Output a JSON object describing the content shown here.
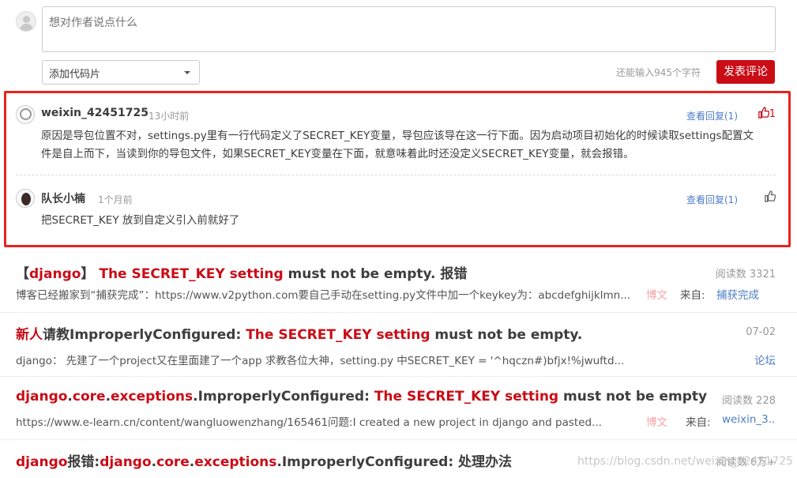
{
  "composer": {
    "placeholder": "想对作者说点什么",
    "code_select": "添加代码片",
    "char_count": "还能输入945个字符",
    "submit": "发表评论"
  },
  "comments": [
    {
      "user": "weixin_42451725",
      "time": "13小时前",
      "reply": "查看回复(1)",
      "likes": "1",
      "text1": "原因是导包位置不对，settings.py里有一行代码定义了SECRET_KEY变量，导包应该导在这一行下面。因为启动项目初始化的时候读取settings配置文",
      "text2": "件是自上而下，当读到你的导包文件，如果SECRET_KEY变量在下面，就意味着此时还没定义SECRET_KEY变量，就会报错。"
    },
    {
      "user": "队长小楠",
      "time": "1个月前",
      "reply": "查看回复(1)",
      "text1": "把SECRET_KEY 放到自定义引入前就好了"
    }
  ],
  "articles": [
    {
      "t1": "【",
      "t2": "django",
      "t3": "】 ",
      "t4": "The SECRET_KEY setting",
      "t5": " must not be empty. 报错",
      "meta": "阅读数 3321",
      "desc": "博客已经搬家到“捕获完成”：https://www.v2python.com要自己手动在setting.py文件中加一个keykey为：abcdefghijklmn...",
      "tag": "博文",
      "src_label": "来自:",
      "src": "捕获完成"
    },
    {
      "t1": "新人",
      "t2": "请教ImproperlyConfigured: ",
      "t3": "The SECRET_KEY setting",
      "t4": " must not be empty.",
      "meta": "07-02",
      "desc": "django： 先建了一个project又在里面建了一个app 求教各位大神，setting.py 中SECRET_KEY = '^hqczn#)bfjx!%jwuftd...",
      "src": "论坛"
    },
    {
      "t1": "django",
      "t2": ".",
      "t3": "core",
      "t4": ".",
      "t5": "exceptions",
      "t6": ".ImproperlyConfigured: ",
      "t7": "The SECRET_KEY setting",
      "t8": " must not be empty",
      "meta": "阅读数 228",
      "desc": "https://www.e-learn.cn/content/wangluowenzhang/165461问题:I created a new project in django and pasted...",
      "tag": "博文",
      "src_label": "来自:",
      "src": "weixin_3..."
    },
    {
      "t1": "django",
      "t2": "报错:",
      "t3": "django",
      "t4": ".",
      "t5": "core",
      "t6": ".",
      "t7": "exceptions",
      "t8": ".ImproperlyConfigured: 处理办法",
      "meta": "阅读数 6万+"
    }
  ],
  "watermark": "https://blog.csdn.net/weixin_42451725",
  "colors": {
    "brand_red": "#ca0c16",
    "link_blue": "#4d7ec5",
    "highlight": "#e8231e"
  }
}
